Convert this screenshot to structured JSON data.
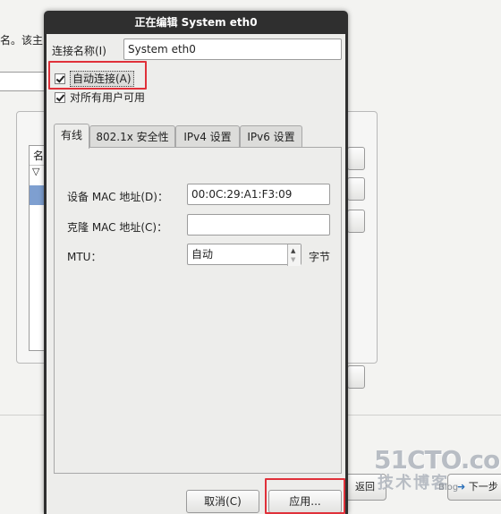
{
  "background": {
    "partial_text": "名。该主",
    "list_header": "名",
    "back_button": "返回",
    "next_button": "下一步"
  },
  "watermark": {
    "site": "51CTO.com",
    "tagline": "技术博客",
    "blog": "Blog"
  },
  "dialog": {
    "title": "正在编辑 System eth0",
    "connection_name_label": "连接名称(I)",
    "connection_name_value": "System eth0",
    "auto_connect": {
      "label": "自动连接(A)",
      "checked": true
    },
    "all_users": {
      "label": "对所有用户可用",
      "checked": true
    },
    "tabs": [
      {
        "label": "有线",
        "active": true
      },
      {
        "label": "802.1x 安全性",
        "active": false
      },
      {
        "label": "IPv4 设置",
        "active": false
      },
      {
        "label": "IPv6 设置",
        "active": false
      }
    ],
    "wired": {
      "device_mac_label": "设备 MAC 地址(D)：",
      "device_mac_value": "00:0C:29:A1:F3:09",
      "clone_mac_label": "克隆 MAC 地址(C)：",
      "clone_mac_value": "",
      "mtu_label": "MTU：",
      "mtu_value": "自动",
      "mtu_unit": "字节"
    },
    "buttons": {
      "cancel": "取消(C)",
      "apply": "应用..."
    }
  },
  "colors": {
    "titlebar": "#2f2f2f",
    "highlight": "#e0313a",
    "dialog_bg": "#ededeb"
  }
}
